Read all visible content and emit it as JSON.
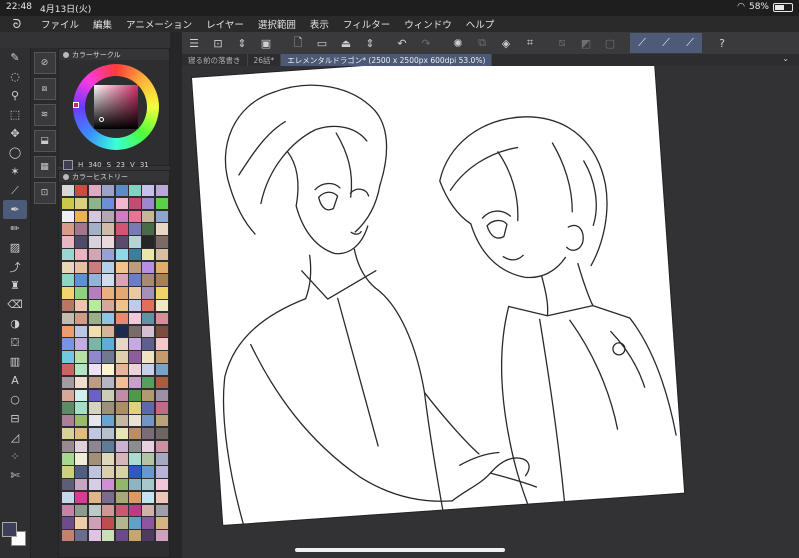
{
  "status": {
    "time": "22:48",
    "date": "4月13日(火)",
    "battery": "58%",
    "battery_level": 0.58
  },
  "menu": [
    "ファイル",
    "編集",
    "アニメーション",
    "レイヤー",
    "選択範囲",
    "表示",
    "フィルター",
    "ウィンドウ",
    "ヘルプ"
  ],
  "tabs": [
    {
      "label": "寝る前の落書き",
      "active": false
    },
    {
      "label": "26話*",
      "active": false
    },
    {
      "label": "エレメンタルドラゴン* (2500 x 2500px 600dpi 53.0%)",
      "active": true
    }
  ],
  "color_panel": {
    "title": "カラーサークル",
    "h": "340",
    "s": "23",
    "v": "31"
  },
  "history_panel": {
    "title": "カラーヒストリー"
  },
  "history_colors": [
    "#d7d7d7",
    "#cf4b3b",
    "#e0a9c4",
    "#9ba3c8",
    "#5a8bcb",
    "#7fd3c0",
    "#c7c0ec",
    "#b8a7d8",
    "#c9c94c",
    "#d8d080",
    "#8bb58a",
    "#6e8fd3",
    "#f0b7ce",
    "#c04e73",
    "#9b88cd",
    "#5ccf4d",
    "#efefef",
    "#eab34c",
    "#d4c7de",
    "#b3a7b3",
    "#d07bc2",
    "#e47796",
    "#c4b79c",
    "#8fa5d0",
    "#d99a8c",
    "#a3768d",
    "#a3b0c6",
    "#cfbba6",
    "#d05673",
    "#7a7ab3",
    "#4b6a4a",
    "#e9d6c5",
    "#e6b7c3",
    "#4e4a6a",
    "#d9d1de",
    "#ecd8dc",
    "#5a4b6d",
    "#b6d3d4",
    "#262626",
    "#7d6a66",
    "#9ad7d0",
    "#e9b3bf",
    "#d4a6b5",
    "#97a1d4",
    "#8bd9ea",
    "#3a7f9d",
    "#e9e6a7",
    "#d6c0a1",
    "#e7d8b5",
    "#e7c0a0",
    "#cb7d7d",
    "#b4cfe8",
    "#f1c38f",
    "#bc9c7c",
    "#b68ee4",
    "#e0ae6a",
    "#8ad5c6",
    "#5b8fd6",
    "#93b4d8",
    "#cfdcee",
    "#daa4b6",
    "#6e7cc6",
    "#a98976",
    "#a97f53",
    "#f1d36f",
    "#8cd27f",
    "#b47ec1",
    "#eab07e",
    "#e4a96f",
    "#e9c8a4",
    "#a68fb9",
    "#f2d36a",
    "#b97662",
    "#eec3b0",
    "#b6ea9c",
    "#d5a89d",
    "#efc38c",
    "#c2c9ea",
    "#e46e5a",
    "#efe8c3",
    "#c1bcae",
    "#cf9d87",
    "#9ab088",
    "#8cc6e4",
    "#e68b6f",
    "#f2c8da",
    "#5e93a5",
    "#d48f9b",
    "#ef9b70",
    "#b9c7e1",
    "#f1ddaf",
    "#d4b59b",
    "#1d2a4e",
    "#7a6b6a",
    "#d6c0cf",
    "#7c4c3d",
    "#7c92e8",
    "#c2ace0",
    "#7ab6a8",
    "#59b0d6",
    "#e8d7c7",
    "#c6a9e2",
    "#5f5f8f",
    "#f2c8c8",
    "#73c7e0",
    "#b6e0a5",
    "#9087cc",
    "#6f7a8f",
    "#e0cfac",
    "#8e5d9b",
    "#f1e3c2",
    "#c69a6b",
    "#cd6262",
    "#afe5c1",
    "#ede0f5",
    "#fdf3cf",
    "#e8b49b",
    "#eed2d7",
    "#c6d0e7",
    "#79a2c6",
    "#a49ba0",
    "#f1ddd0",
    "#bd9b84",
    "#b7b4c3",
    "#f1bf97",
    "#c7a0cc",
    "#53a15e",
    "#ab5c3d",
    "#d7a996",
    "#d1f1f0",
    "#6a61c3",
    "#c9ceb5",
    "#c08ea3",
    "#4d9a4c",
    "#b29a70",
    "#9c90a6",
    "#5c8b65",
    "#a4e0c3",
    "#d7d1bf",
    "#9d8f7a",
    "#ac8e64",
    "#e0d07f",
    "#5d6aa8",
    "#c26a83",
    "#ab7f95",
    "#99ba6e",
    "#e1e6ef",
    "#66a5d4",
    "#c5b7a0",
    "#e8e2d5",
    "#7394c4",
    "#b9a37f",
    "#d6d396",
    "#e2bc7f",
    "#c2c6e2",
    "#b7c1ce",
    "#e7e4b5",
    "#bd8d66",
    "#7b6c79",
    "#6f6560",
    "#9a8a8f",
    "#e1d0d9",
    "#8b8594",
    "#5e7b97",
    "#cbb2d2",
    "#8c8d8e",
    "#e8cfe0",
    "#ce8fa3",
    "#a6d88d",
    "#f0ecd8",
    "#a38f76",
    "#ded8ba",
    "#d7b5b9",
    "#abdcd0",
    "#b3c4a4",
    "#a6a7c3",
    "#cbd180",
    "#4f5f82",
    "#bcc4df",
    "#d8cfaf",
    "#d9d2a5",
    "#3156c6",
    "#6b98cc",
    "#b9b2d9",
    "#5d5d75",
    "#c5a6c3",
    "#d8cde7",
    "#cf8fd4",
    "#93b66d",
    "#8bb5c2",
    "#a6c9ce",
    "#f2c8d8",
    "#c6d7ea",
    "#d93a92",
    "#e1b489",
    "#7d6b8f",
    "#a8a874",
    "#da9a65",
    "#c1e4f0",
    "#efc5b8",
    "#c783a7",
    "#8b9c8e",
    "#bcc9c8",
    "#cf9897",
    "#c85874",
    "#b53e89",
    "#d2b2a8",
    "#9f9fa9",
    "#6e4c8c",
    "#f0cda5",
    "#cd9fb9",
    "#c04d4d",
    "#b5b68e",
    "#5ea3c4",
    "#8f56a0",
    "#d6b383",
    "#c38270",
    "#6b6b8c",
    "#e0c2e5",
    "#c8e0b5",
    "#6b4a8c",
    "#c7a66e",
    "#4d3b60",
    "#d0a0bf"
  ],
  "bottom_swatches": [
    "#5b2a2a",
    "#2f6a3a",
    "#2a3f8a"
  ]
}
